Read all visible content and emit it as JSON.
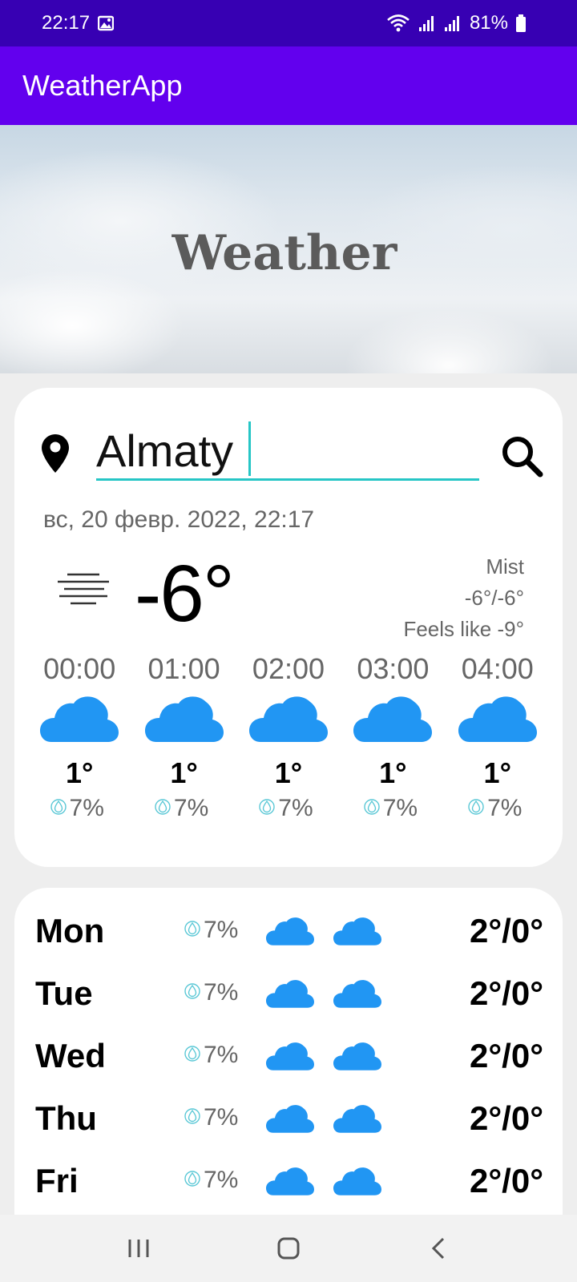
{
  "status_bar": {
    "time": "22:17",
    "battery": "81%"
  },
  "app_bar": {
    "title": "WeatherApp"
  },
  "hero": {
    "title": "Weather"
  },
  "search": {
    "city": "Almaty"
  },
  "current": {
    "datetime": "вс, 20 февр. 2022, 22:17",
    "temp": "-6°",
    "condition": "Mist",
    "range": "-6°/-6°",
    "feels_like": "Feels like -9°",
    "icon": "mist-icon"
  },
  "hourly": [
    {
      "time": "00:00",
      "temp": "1°",
      "rain": "7%",
      "icon": "cloud-icon"
    },
    {
      "time": "01:00",
      "temp": "1°",
      "rain": "7%",
      "icon": "cloud-icon"
    },
    {
      "time": "02:00",
      "temp": "1°",
      "rain": "7%",
      "icon": "cloud-icon"
    },
    {
      "time": "03:00",
      "temp": "1°",
      "rain": "7%",
      "icon": "cloud-icon"
    },
    {
      "time": "04:00",
      "temp": "1°",
      "rain": "7%",
      "icon": "cloud-icon"
    }
  ],
  "daily": [
    {
      "day": "Mon",
      "rain": "7%",
      "temp": "2°/0°"
    },
    {
      "day": "Tue",
      "rain": "7%",
      "temp": "2°/0°"
    },
    {
      "day": "Wed",
      "rain": "7%",
      "temp": "2°/0°"
    },
    {
      "day": "Thu",
      "rain": "7%",
      "temp": "2°/0°"
    },
    {
      "day": "Fri",
      "rain": "7%",
      "temp": "2°/0°"
    }
  ],
  "colors": {
    "status_bar": "#3700b3",
    "app_bar": "#6200ee",
    "cloud": "#2196f3",
    "accent": "#26c6c6"
  }
}
